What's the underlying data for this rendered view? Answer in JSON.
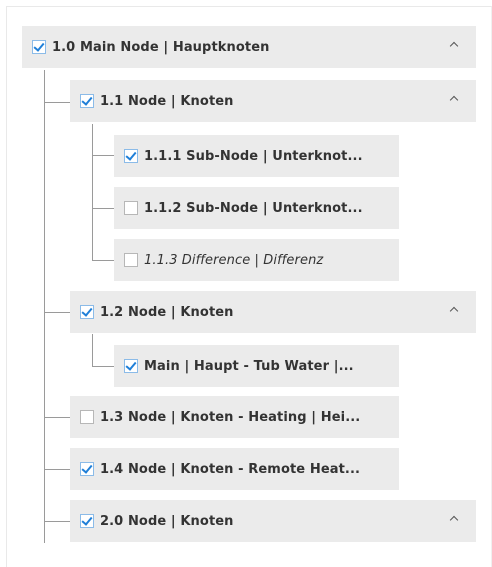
{
  "tree": {
    "root": {
      "label": "1.0 Main Node | Hauptknoten",
      "checked": true,
      "expanded": true
    },
    "n11": {
      "label": "1.1 Node | Knoten",
      "checked": true,
      "expanded": true
    },
    "n111": {
      "label": "1.1.1 Sub-Node | Unterknot...",
      "checked": true
    },
    "n112": {
      "label": "1.1.2 Sub-Node | Unterknot...",
      "checked": false
    },
    "n113": {
      "label": "1.1.3 Difference | Differenz",
      "checked": false,
      "style": "italic"
    },
    "n12": {
      "label": "1.2 Node | Knoten",
      "checked": true,
      "expanded": true
    },
    "n121": {
      "label": "Main | Haupt - Tub Water |...",
      "checked": true
    },
    "n13": {
      "label": "1.3 Node | Knoten - Heating | Hei...",
      "checked": false
    },
    "n14": {
      "label": "1.4 Node | Knoten - Remote Heat...",
      "checked": true
    },
    "n20": {
      "label": "2.0 Node | Knoten",
      "checked": true,
      "expanded": true
    }
  },
  "icons": {
    "checkbox_checked": "checkbox-checked-icon",
    "checkbox_unchecked": "checkbox-unchecked-icon",
    "collapse": "chevron-up-icon"
  },
  "colors": {
    "row_background": "#ebebeb",
    "check_accent": "#1f7fd8",
    "connector_line": "#9a9a9a"
  }
}
